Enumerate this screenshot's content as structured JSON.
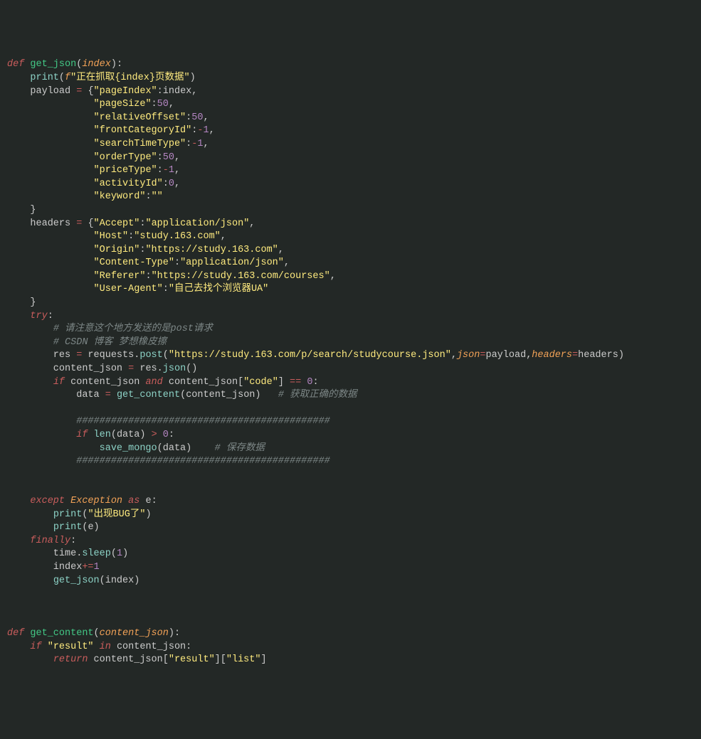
{
  "code": {
    "lines": [
      [
        {
          "c": "kw",
          "t": "def "
        },
        {
          "c": "fn",
          "t": "get_json"
        },
        {
          "c": "punc",
          "t": "("
        },
        {
          "c": "param",
          "t": "index"
        },
        {
          "c": "punc",
          "t": ")"
        },
        {
          "c": "punc",
          "t": ":"
        }
      ],
      [
        {
          "c": "plain",
          "t": "    "
        },
        {
          "c": "fncall",
          "t": "print"
        },
        {
          "c": "punc",
          "t": "("
        },
        {
          "c": "param",
          "t": "f"
        },
        {
          "c": "str",
          "t": "\"正在抓取{index}页数据\""
        },
        {
          "c": "punc",
          "t": ")"
        }
      ],
      [
        {
          "c": "plain",
          "t": "    payload "
        },
        {
          "c": "op",
          "t": "="
        },
        {
          "c": "plain",
          "t": " "
        },
        {
          "c": "punc",
          "t": "{"
        },
        {
          "c": "str",
          "t": "\"pageIndex\""
        },
        {
          "c": "punc",
          "t": ":"
        },
        {
          "c": "plain",
          "t": "index"
        },
        {
          "c": "punc",
          "t": ","
        }
      ],
      [
        {
          "c": "plain",
          "t": "               "
        },
        {
          "c": "str",
          "t": "\"pageSize\""
        },
        {
          "c": "punc",
          "t": ":"
        },
        {
          "c": "num",
          "t": "50"
        },
        {
          "c": "punc",
          "t": ","
        }
      ],
      [
        {
          "c": "plain",
          "t": "               "
        },
        {
          "c": "str",
          "t": "\"relativeOffset\""
        },
        {
          "c": "punc",
          "t": ":"
        },
        {
          "c": "num",
          "t": "50"
        },
        {
          "c": "punc",
          "t": ","
        }
      ],
      [
        {
          "c": "plain",
          "t": "               "
        },
        {
          "c": "str",
          "t": "\"frontCategoryId\""
        },
        {
          "c": "punc",
          "t": ":"
        },
        {
          "c": "op",
          "t": "-"
        },
        {
          "c": "num",
          "t": "1"
        },
        {
          "c": "punc",
          "t": ","
        }
      ],
      [
        {
          "c": "plain",
          "t": "               "
        },
        {
          "c": "str",
          "t": "\"searchTimeType\""
        },
        {
          "c": "punc",
          "t": ":"
        },
        {
          "c": "op",
          "t": "-"
        },
        {
          "c": "num",
          "t": "1"
        },
        {
          "c": "punc",
          "t": ","
        }
      ],
      [
        {
          "c": "plain",
          "t": "               "
        },
        {
          "c": "str",
          "t": "\"orderType\""
        },
        {
          "c": "punc",
          "t": ":"
        },
        {
          "c": "num",
          "t": "50"
        },
        {
          "c": "punc",
          "t": ","
        }
      ],
      [
        {
          "c": "plain",
          "t": "               "
        },
        {
          "c": "str",
          "t": "\"priceType\""
        },
        {
          "c": "punc",
          "t": ":"
        },
        {
          "c": "op",
          "t": "-"
        },
        {
          "c": "num",
          "t": "1"
        },
        {
          "c": "punc",
          "t": ","
        }
      ],
      [
        {
          "c": "plain",
          "t": "               "
        },
        {
          "c": "str",
          "t": "\"activityId\""
        },
        {
          "c": "punc",
          "t": ":"
        },
        {
          "c": "num",
          "t": "0"
        },
        {
          "c": "punc",
          "t": ","
        }
      ],
      [
        {
          "c": "plain",
          "t": "               "
        },
        {
          "c": "str",
          "t": "\"keyword\""
        },
        {
          "c": "punc",
          "t": ":"
        },
        {
          "c": "str",
          "t": "\"\""
        }
      ],
      [
        {
          "c": "plain",
          "t": "    "
        },
        {
          "c": "punc",
          "t": "}"
        }
      ],
      [
        {
          "c": "plain",
          "t": "    headers "
        },
        {
          "c": "op",
          "t": "="
        },
        {
          "c": "plain",
          "t": " "
        },
        {
          "c": "punc",
          "t": "{"
        },
        {
          "c": "str",
          "t": "\"Accept\""
        },
        {
          "c": "punc",
          "t": ":"
        },
        {
          "c": "str",
          "t": "\"application/json\""
        },
        {
          "c": "punc",
          "t": ","
        }
      ],
      [
        {
          "c": "plain",
          "t": "               "
        },
        {
          "c": "str",
          "t": "\"Host\""
        },
        {
          "c": "punc",
          "t": ":"
        },
        {
          "c": "str",
          "t": "\"study.163.com\""
        },
        {
          "c": "punc",
          "t": ","
        }
      ],
      [
        {
          "c": "plain",
          "t": "               "
        },
        {
          "c": "str",
          "t": "\"Origin\""
        },
        {
          "c": "punc",
          "t": ":"
        },
        {
          "c": "str",
          "t": "\"https://study.163.com\""
        },
        {
          "c": "punc",
          "t": ","
        }
      ],
      [
        {
          "c": "plain",
          "t": "               "
        },
        {
          "c": "str",
          "t": "\"Content-Type\""
        },
        {
          "c": "punc",
          "t": ":"
        },
        {
          "c": "str",
          "t": "\"application/json\""
        },
        {
          "c": "punc",
          "t": ","
        }
      ],
      [
        {
          "c": "plain",
          "t": "               "
        },
        {
          "c": "str",
          "t": "\"Referer\""
        },
        {
          "c": "punc",
          "t": ":"
        },
        {
          "c": "str",
          "t": "\"https://study.163.com/courses\""
        },
        {
          "c": "punc",
          "t": ","
        }
      ],
      [
        {
          "c": "plain",
          "t": "               "
        },
        {
          "c": "str",
          "t": "\"User-Agent\""
        },
        {
          "c": "punc",
          "t": ":"
        },
        {
          "c": "str",
          "t": "\"自己去找个浏览器UA\""
        }
      ],
      [
        {
          "c": "plain",
          "t": "    "
        },
        {
          "c": "punc",
          "t": "}"
        }
      ],
      [
        {
          "c": "plain",
          "t": "    "
        },
        {
          "c": "kw",
          "t": "try"
        },
        {
          "c": "punc",
          "t": ":"
        }
      ],
      [
        {
          "c": "plain",
          "t": "        "
        },
        {
          "c": "cmt",
          "t": "# 请注意这个地方发送的是post请求"
        }
      ],
      [
        {
          "c": "plain",
          "t": "        "
        },
        {
          "c": "cmt",
          "t": "# CSDN 博客 梦想橡皮擦"
        }
      ],
      [
        {
          "c": "plain",
          "t": "        res "
        },
        {
          "c": "op",
          "t": "="
        },
        {
          "c": "plain",
          "t": " requests"
        },
        {
          "c": "punc",
          "t": "."
        },
        {
          "c": "fncall",
          "t": "post"
        },
        {
          "c": "punc",
          "t": "("
        },
        {
          "c": "str",
          "t": "\"https://study.163.com/p/search/studycourse.json\""
        },
        {
          "c": "punc",
          "t": ","
        },
        {
          "c": "param",
          "t": "json"
        },
        {
          "c": "op",
          "t": "="
        },
        {
          "c": "plain",
          "t": "payload"
        },
        {
          "c": "punc",
          "t": ","
        },
        {
          "c": "param",
          "t": "headers"
        },
        {
          "c": "op",
          "t": "="
        },
        {
          "c": "plain",
          "t": "headers"
        },
        {
          "c": "punc",
          "t": ")"
        }
      ],
      [
        {
          "c": "plain",
          "t": "        content_json "
        },
        {
          "c": "op",
          "t": "="
        },
        {
          "c": "plain",
          "t": " res"
        },
        {
          "c": "punc",
          "t": "."
        },
        {
          "c": "fncall",
          "t": "json"
        },
        {
          "c": "punc",
          "t": "()"
        }
      ],
      [
        {
          "c": "plain",
          "t": "        "
        },
        {
          "c": "kw",
          "t": "if"
        },
        {
          "c": "plain",
          "t": " content_json "
        },
        {
          "c": "kw",
          "t": "and"
        },
        {
          "c": "plain",
          "t": " content_json"
        },
        {
          "c": "punc",
          "t": "["
        },
        {
          "c": "str",
          "t": "\"code\""
        },
        {
          "c": "punc",
          "t": "]"
        },
        {
          "c": "plain",
          "t": " "
        },
        {
          "c": "op",
          "t": "=="
        },
        {
          "c": "plain",
          "t": " "
        },
        {
          "c": "num",
          "t": "0"
        },
        {
          "c": "punc",
          "t": ":"
        }
      ],
      [
        {
          "c": "plain",
          "t": "            data "
        },
        {
          "c": "op",
          "t": "="
        },
        {
          "c": "plain",
          "t": " "
        },
        {
          "c": "fncall",
          "t": "get_content"
        },
        {
          "c": "punc",
          "t": "("
        },
        {
          "c": "plain",
          "t": "content_json"
        },
        {
          "c": "punc",
          "t": ")"
        },
        {
          "c": "plain",
          "t": "   "
        },
        {
          "c": "cmt",
          "t": "# 获取正确的数据"
        }
      ],
      [
        {
          "c": "plain",
          "t": ""
        }
      ],
      [
        {
          "c": "plain",
          "t": "            "
        },
        {
          "c": "cmt",
          "t": "############################################"
        }
      ],
      [
        {
          "c": "plain",
          "t": "            "
        },
        {
          "c": "kw",
          "t": "if"
        },
        {
          "c": "plain",
          "t": " "
        },
        {
          "c": "fncall",
          "t": "len"
        },
        {
          "c": "punc",
          "t": "("
        },
        {
          "c": "plain",
          "t": "data"
        },
        {
          "c": "punc",
          "t": ")"
        },
        {
          "c": "plain",
          "t": " "
        },
        {
          "c": "op",
          "t": ">"
        },
        {
          "c": "plain",
          "t": " "
        },
        {
          "c": "num",
          "t": "0"
        },
        {
          "c": "punc",
          "t": ":"
        }
      ],
      [
        {
          "c": "plain",
          "t": "                "
        },
        {
          "c": "fncall",
          "t": "save_mongo"
        },
        {
          "c": "punc",
          "t": "("
        },
        {
          "c": "plain",
          "t": "data"
        },
        {
          "c": "punc",
          "t": ")"
        },
        {
          "c": "plain",
          "t": "    "
        },
        {
          "c": "cmt",
          "t": "# 保存数据"
        }
      ],
      [
        {
          "c": "plain",
          "t": "            "
        },
        {
          "c": "cmt",
          "t": "############################################"
        }
      ],
      [
        {
          "c": "plain",
          "t": ""
        }
      ],
      [
        {
          "c": "plain",
          "t": ""
        }
      ],
      [
        {
          "c": "plain",
          "t": "    "
        },
        {
          "c": "kw",
          "t": "except"
        },
        {
          "c": "plain",
          "t": " "
        },
        {
          "c": "param",
          "t": "Exception"
        },
        {
          "c": "plain",
          "t": " "
        },
        {
          "c": "kw",
          "t": "as"
        },
        {
          "c": "plain",
          "t": " e"
        },
        {
          "c": "punc",
          "t": ":"
        }
      ],
      [
        {
          "c": "plain",
          "t": "        "
        },
        {
          "c": "fncall",
          "t": "print"
        },
        {
          "c": "punc",
          "t": "("
        },
        {
          "c": "str",
          "t": "\"出现BUG了\""
        },
        {
          "c": "punc",
          "t": ")"
        }
      ],
      [
        {
          "c": "plain",
          "t": "        "
        },
        {
          "c": "fncall",
          "t": "print"
        },
        {
          "c": "punc",
          "t": "("
        },
        {
          "c": "plain",
          "t": "e"
        },
        {
          "c": "punc",
          "t": ")"
        }
      ],
      [
        {
          "c": "plain",
          "t": "    "
        },
        {
          "c": "kw",
          "t": "finally"
        },
        {
          "c": "punc",
          "t": ":"
        }
      ],
      [
        {
          "c": "plain",
          "t": "        time"
        },
        {
          "c": "punc",
          "t": "."
        },
        {
          "c": "fncall",
          "t": "sleep"
        },
        {
          "c": "punc",
          "t": "("
        },
        {
          "c": "num",
          "t": "1"
        },
        {
          "c": "punc",
          "t": ")"
        }
      ],
      [
        {
          "c": "plain",
          "t": "        index"
        },
        {
          "c": "op",
          "t": "+="
        },
        {
          "c": "num",
          "t": "1"
        }
      ],
      [
        {
          "c": "plain",
          "t": "        "
        },
        {
          "c": "fncall",
          "t": "get_json"
        },
        {
          "c": "punc",
          "t": "("
        },
        {
          "c": "plain",
          "t": "index"
        },
        {
          "c": "punc",
          "t": ")"
        }
      ],
      [
        {
          "c": "plain",
          "t": ""
        }
      ],
      [
        {
          "c": "plain",
          "t": ""
        }
      ],
      [
        {
          "c": "plain",
          "t": ""
        }
      ],
      [
        {
          "c": "kw",
          "t": "def "
        },
        {
          "c": "fn",
          "t": "get_content"
        },
        {
          "c": "punc",
          "t": "("
        },
        {
          "c": "param",
          "t": "content_json"
        },
        {
          "c": "punc",
          "t": ")"
        },
        {
          "c": "punc",
          "t": ":"
        }
      ],
      [
        {
          "c": "plain",
          "t": "    "
        },
        {
          "c": "kw",
          "t": "if"
        },
        {
          "c": "plain",
          "t": " "
        },
        {
          "c": "str",
          "t": "\"result\""
        },
        {
          "c": "plain",
          "t": " "
        },
        {
          "c": "kw",
          "t": "in"
        },
        {
          "c": "plain",
          "t": " content_json"
        },
        {
          "c": "punc",
          "t": ":"
        }
      ],
      [
        {
          "c": "plain",
          "t": "        "
        },
        {
          "c": "kw",
          "t": "return"
        },
        {
          "c": "plain",
          "t": " content_json"
        },
        {
          "c": "punc",
          "t": "["
        },
        {
          "c": "str",
          "t": "\"result\""
        },
        {
          "c": "punc",
          "t": "]["
        },
        {
          "c": "str",
          "t": "\"list\""
        },
        {
          "c": "punc",
          "t": "]"
        }
      ]
    ]
  }
}
